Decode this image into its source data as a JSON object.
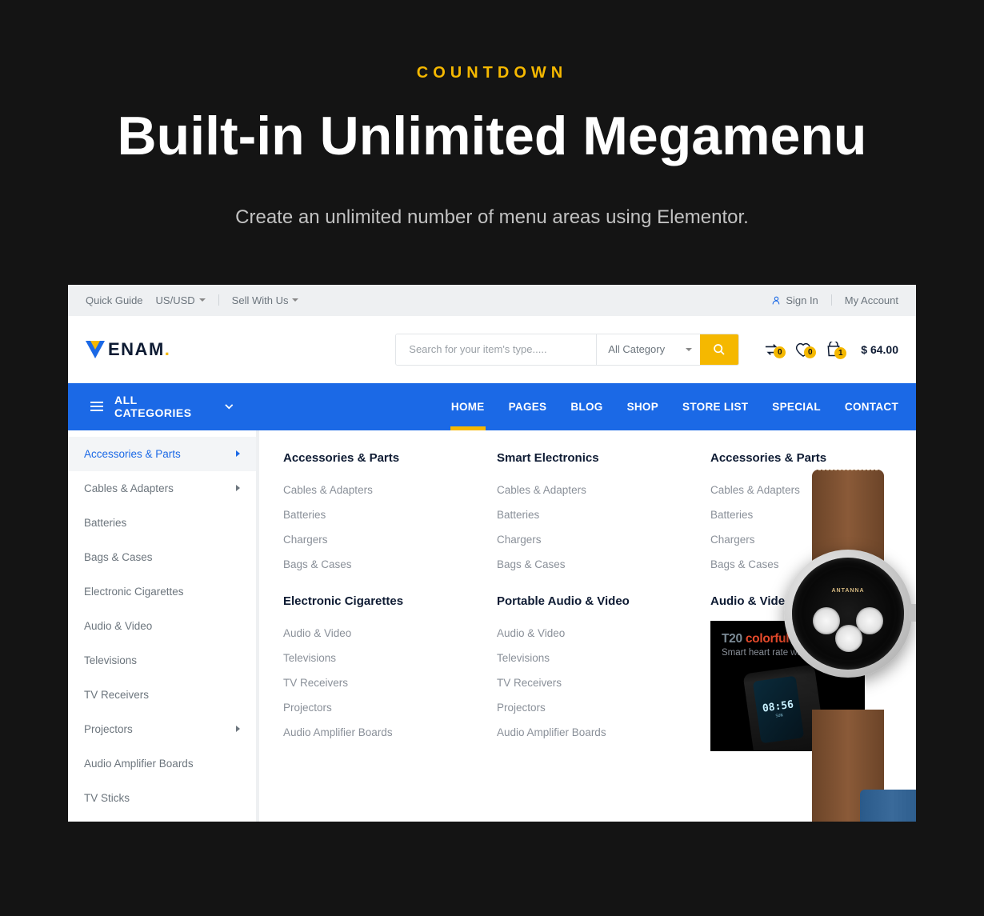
{
  "hero": {
    "eyebrow": "COUNTDOWN",
    "title": "Built-in Unlimited Megamenu",
    "subtitle": "Create an unlimited number of menu areas using Elementor."
  },
  "topbar": {
    "quick_guide": "Quick Guide",
    "currency": "US/USD",
    "sell": "Sell With Us",
    "sign_in": "Sign In",
    "my_account": "My Account"
  },
  "logo": {
    "text": "ENAM",
    "dot": "."
  },
  "search": {
    "placeholder": "Search for your item's type.....",
    "category": "All Category"
  },
  "header_icons": {
    "compare_count": "0",
    "wishlist_count": "0",
    "cart_count": "1",
    "cart_total": "$ 64.00"
  },
  "nav": {
    "all_categories": "ALL CATEGORIES",
    "links": [
      "HOME",
      "PAGES",
      "BLOG",
      "SHOP",
      "STORE LIST",
      "SPECIAL",
      "CONTACT"
    ],
    "active_index": 0
  },
  "sidebar": [
    {
      "label": "Accessories & Parts",
      "arrow": true,
      "active": true
    },
    {
      "label": "Cables & Adapters",
      "arrow": true
    },
    {
      "label": "Batteries"
    },
    {
      "label": "Bags & Cases"
    },
    {
      "label": "Electronic Cigarettes"
    },
    {
      "label": "Audio & Video"
    },
    {
      "label": "Televisions"
    },
    {
      "label": "TV Receivers"
    },
    {
      "label": "Projectors",
      "arrow": true
    },
    {
      "label": "Audio Amplifier Boards"
    },
    {
      "label": "TV Sticks"
    }
  ],
  "mega": {
    "col1": {
      "h1": "Accessories & Parts",
      "items1": [
        "Cables & Adapters",
        "Batteries",
        "Chargers",
        "Bags & Cases"
      ],
      "h2": "Electronic Cigarettes",
      "items2": [
        "Audio & Video",
        "Televisions",
        "TV Receivers",
        "Projectors",
        "Audio Amplifier Boards"
      ]
    },
    "col2": {
      "h1": "Smart Electronics",
      "items1": [
        "Cables & Adapters",
        "Batteries",
        "Chargers",
        "Bags & Cases"
      ],
      "h2": "Portable Audio & Video",
      "items2": [
        "Audio & Video",
        "Televisions",
        "TV Receivers",
        "Projectors",
        "Audio Amplifier Boards"
      ]
    },
    "col3": {
      "h1": "Accessories & Parts",
      "items1": [
        "Cables & Adapters",
        "Batteries",
        "Chargers",
        "Bags & Cases"
      ],
      "h2": "Audio & Video",
      "promo": {
        "title1": "T20 ",
        "title2": "colorful screen",
        "sub": "Smart heart rate watch",
        "time": "08:56",
        "day": "SUN"
      }
    }
  },
  "watch": {
    "brand": "ANTANNA"
  }
}
